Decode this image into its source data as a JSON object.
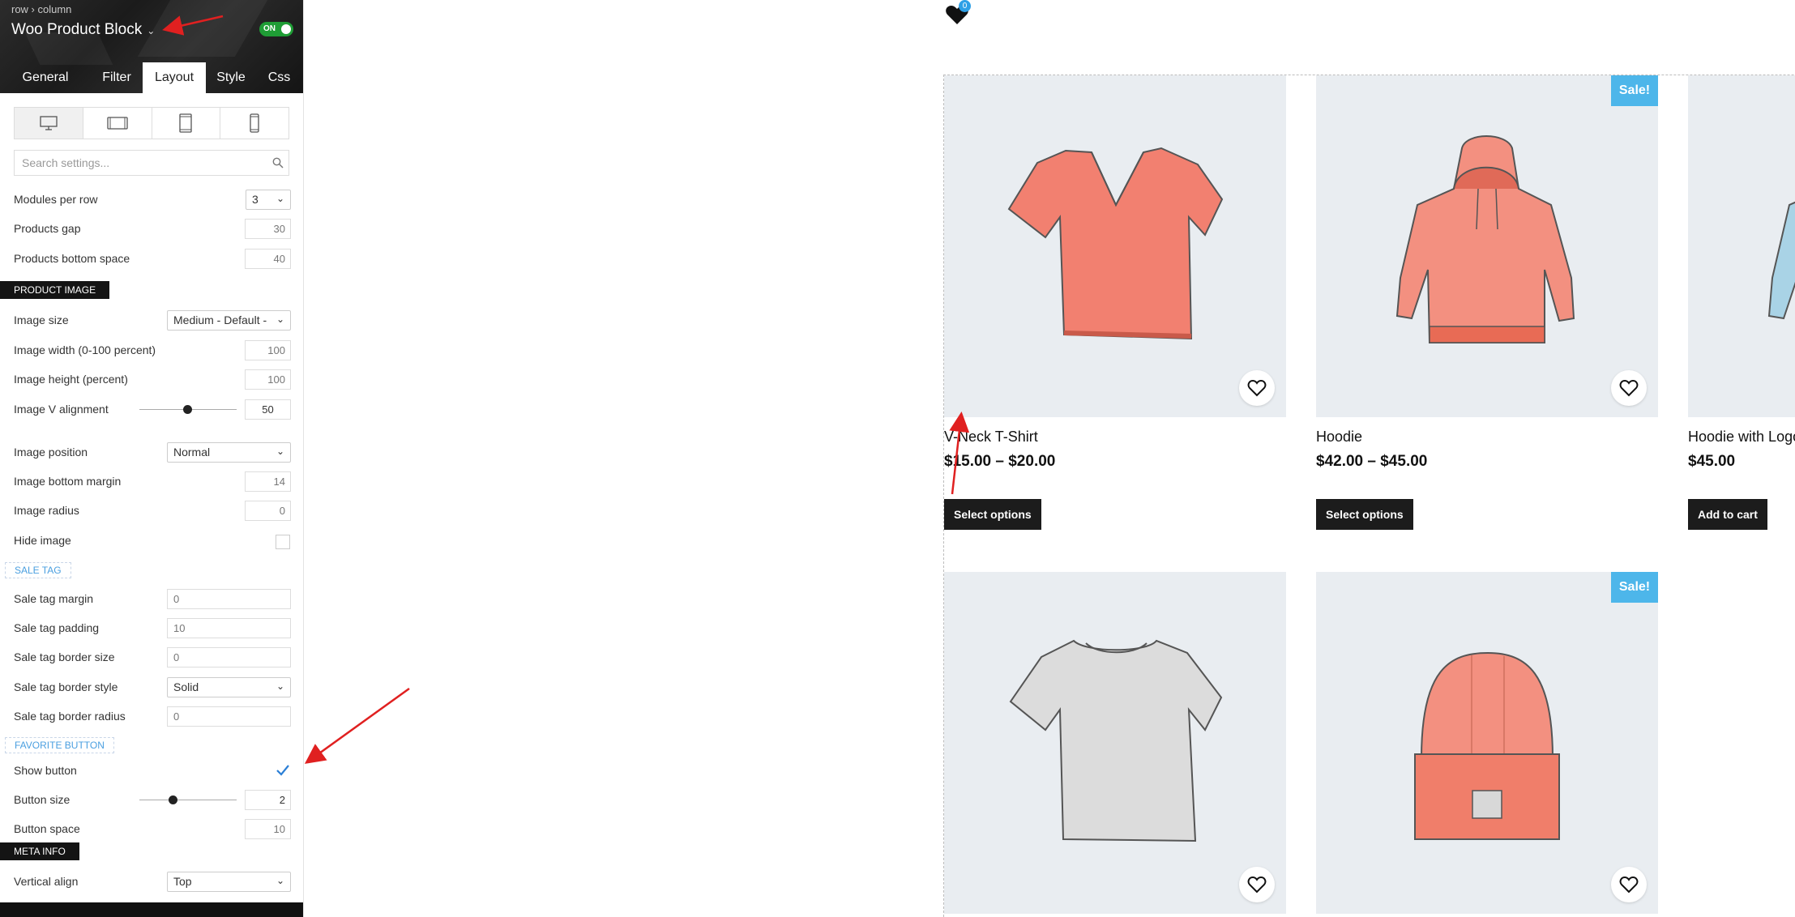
{
  "sidebar": {
    "breadcrumb": "row › column",
    "widget_title": "Woo Product Block",
    "toggle_label": "ON",
    "tabs": [
      "General",
      "Filter",
      "Layout",
      "Style",
      "Css"
    ],
    "active_tab": "Layout",
    "devices": [
      "desktop-icon",
      "tablet-landscape-icon",
      "tablet-portrait-icon",
      "mobile-icon"
    ],
    "search_placeholder": "Search settings...",
    "settings": {
      "modules_per_row": {
        "label": "Modules per row",
        "value": "3"
      },
      "products_gap": {
        "label": "Products gap",
        "value": "30"
      },
      "products_bottom_space": {
        "label": "Products bottom space",
        "value": "40"
      },
      "product_image_heading": "PRODUCT IMAGE",
      "image_size": {
        "label": "Image size",
        "value": "Medium - Default - "
      },
      "image_width": {
        "label": "Image width (0-100 percent)",
        "value": "100"
      },
      "image_height": {
        "label": "Image height (percent)",
        "value": "100"
      },
      "image_v_alignment": {
        "label": "Image V alignment",
        "value": "50"
      },
      "image_position": {
        "label": "Image position",
        "value": "Normal"
      },
      "image_bottom_margin": {
        "label": "Image bottom margin",
        "value": "14"
      },
      "image_radius": {
        "label": "Image radius",
        "value": "0"
      },
      "hide_image": {
        "label": "Hide image"
      },
      "sale_tag_heading": "SALE TAG",
      "sale_tag_margin": {
        "label": "Sale tag margin",
        "value": "0"
      },
      "sale_tag_padding": {
        "label": "Sale tag padding",
        "value": "10"
      },
      "sale_tag_border_size": {
        "label": "Sale tag border size",
        "value": "0"
      },
      "sale_tag_border_style": {
        "label": "Sale tag border style",
        "value": "Solid"
      },
      "sale_tag_border_radius": {
        "label": "Sale tag border radius",
        "value": "0"
      },
      "favorite_heading": "FAVORITE BUTTON",
      "show_button": {
        "label": "Show button",
        "checked": true
      },
      "button_size": {
        "label": "Button size",
        "value": "2"
      },
      "button_space": {
        "label": "Button space",
        "value": "10"
      },
      "meta_info_heading": "META INFO",
      "vertical_align": {
        "label": "Vertical align",
        "value": "Top"
      }
    }
  },
  "header": {
    "wishlist_count": "0"
  },
  "products": [
    {
      "name": "V-Neck T-Shirt",
      "price": "$15.00 – $20.00",
      "button": "Select options",
      "sale": "",
      "image": "vneck-tshirt"
    },
    {
      "name": "Hoodie",
      "price": "$42.00 – $45.00",
      "button": "Select options",
      "sale": "Sale!",
      "image": "hoodie"
    },
    {
      "name": "Hoodie with Logo",
      "price": "$45.00",
      "button": "Add to cart",
      "sale": "",
      "image": "hoodie-with-logo"
    },
    {
      "name": "",
      "price": "",
      "button": "",
      "sale": "",
      "image": "tshirt-grey"
    },
    {
      "name": "",
      "price": "",
      "button": "",
      "sale": "Sale!",
      "image": "beanie"
    }
  ],
  "colors": {
    "accent": "#4db6ea",
    "toggle_on": "#1f9d35",
    "annotation": "#e02020",
    "product_bg": "#e9edf1"
  }
}
